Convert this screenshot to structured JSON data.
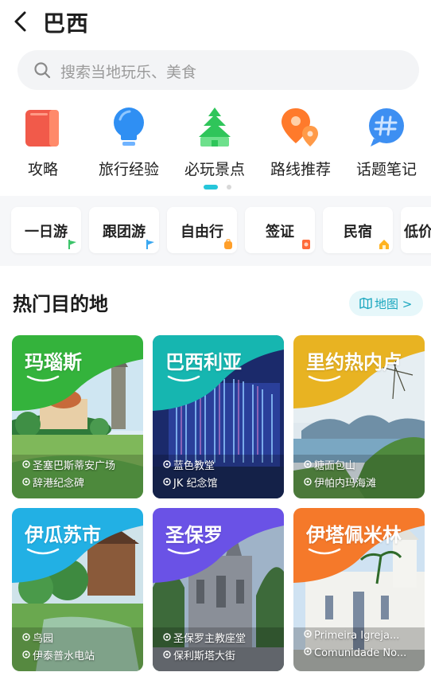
{
  "header": {
    "title": "巴西"
  },
  "search": {
    "placeholder": "搜索当地玩乐、美食"
  },
  "categories": [
    {
      "label": "攻略",
      "icon": "guide-book-icon",
      "color": "#f15a4a"
    },
    {
      "label": "旅行经验",
      "icon": "lightbulb-icon",
      "color": "#2f8ff3"
    },
    {
      "label": "必玩景点",
      "icon": "pagoda-icon",
      "color": "#2fc55a"
    },
    {
      "label": "路线推荐",
      "icon": "route-pin-icon",
      "color": "#ff7a2b"
    },
    {
      "label": "话题笔记",
      "icon": "hashtag-chat-icon",
      "color": "#3d8ff2"
    }
  ],
  "chips": [
    {
      "label": "一日游",
      "badge": "flag-icon",
      "badge_color": "#3cc46a"
    },
    {
      "label": "跟团游",
      "badge": "flag-icon",
      "badge_color": "#39a7f0"
    },
    {
      "label": "自由行",
      "badge": "backpack-icon",
      "badge_color": "#ff9f2a"
    },
    {
      "label": "签证",
      "badge": "passport-icon",
      "badge_color": "#ff6a3a"
    },
    {
      "label": "民宿",
      "badge": "house-icon",
      "badge_color": "#ffb320"
    },
    {
      "label": "低价"
    }
  ],
  "section": {
    "title": "热门目的地",
    "map_label": "地图 >"
  },
  "cards": [
    {
      "name": "玛瑙斯",
      "spots": [
        "圣塞巴斯蒂安广场",
        "辞港纪念碑"
      ],
      "colors": [
        "#32b43c",
        "#8fe24a"
      ]
    },
    {
      "name": "巴西利亚",
      "spots": [
        "蓝色教堂",
        "JK 纪念馆"
      ],
      "colors": [
        "#16b6a6",
        "#4fd6e8"
      ]
    },
    {
      "name": "里约热内卢",
      "spots": [
        "糖面包山",
        "伊帕内玛海滩"
      ],
      "colors": [
        "#f2b322",
        "#a9d43a"
      ]
    },
    {
      "name": "伊瓜苏市",
      "spots": [
        "鸟园",
        "伊泰普水电站"
      ],
      "colors": [
        "#22b6e8",
        "#6fd5ff"
      ]
    },
    {
      "name": "圣保罗",
      "spots": [
        "圣保罗主教座堂",
        "保利斯塔大街"
      ],
      "colors": [
        "#7c4de8",
        "#4f7df2"
      ]
    },
    {
      "name": "伊塔佩米林",
      "spots": [
        "Primeira Igreja...",
        "Comunidade No..."
      ],
      "colors": [
        "#f5782a",
        "#ffb04a"
      ]
    }
  ]
}
